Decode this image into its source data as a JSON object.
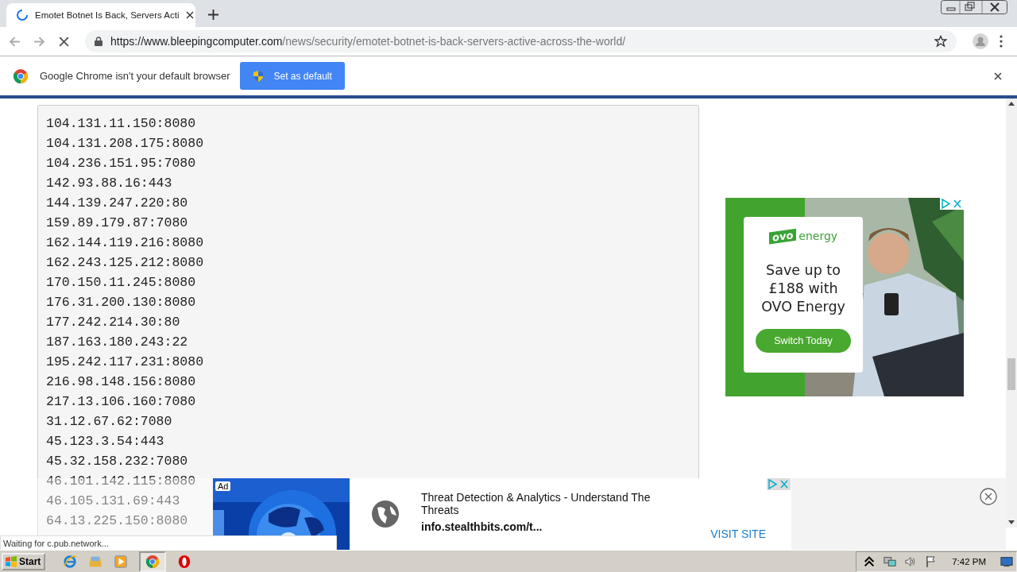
{
  "tab": {
    "title": "Emotet Botnet Is Back, Servers Acti",
    "loading": true
  },
  "address_bar": {
    "domain": "https://www.bleepingcomputer.com",
    "path": "/news/security/emotet-botnet-is-back-servers-active-across-the-world/"
  },
  "infobar": {
    "message": "Google Chrome isn't your default browser",
    "button": "Set as default"
  },
  "code_lines": [
    "104.131.11.150:8080",
    "104.131.208.175:8080",
    "104.236.151.95:7080",
    "142.93.88.16:443",
    "144.139.247.220:80",
    "159.89.179.87:7080",
    "162.144.119.216:8080",
    "162.243.125.212:8080",
    "170.150.11.245:8080",
    "176.31.200.130:8080",
    "177.242.214.30:80",
    "187.163.180.243:22",
    "195.242.117.231:8080",
    "216.98.148.156:8080",
    "217.13.106.160:7080",
    "31.12.67.62:7080",
    "45.123.3.54:443",
    "45.32.158.232:7080",
    "46.101.142.115:8080",
    "46.105.131.69:443",
    "64.13.225.150:8080"
  ],
  "side_ad": {
    "logo_mark": "ovo",
    "logo_word": "energy",
    "headline": "Save up to £188 with OVO Energy",
    "button": "Switch Today"
  },
  "bottom_ad": {
    "badge": "Ad",
    "title": "Threat Detection & Analytics - Understand The Threats",
    "url": "info.stealthbits.com/t...",
    "cta": "VISIT SITE"
  },
  "status": "Waiting for c.pub.network...",
  "taskbar": {
    "start": "Start",
    "clock": "7:42 PM"
  }
}
